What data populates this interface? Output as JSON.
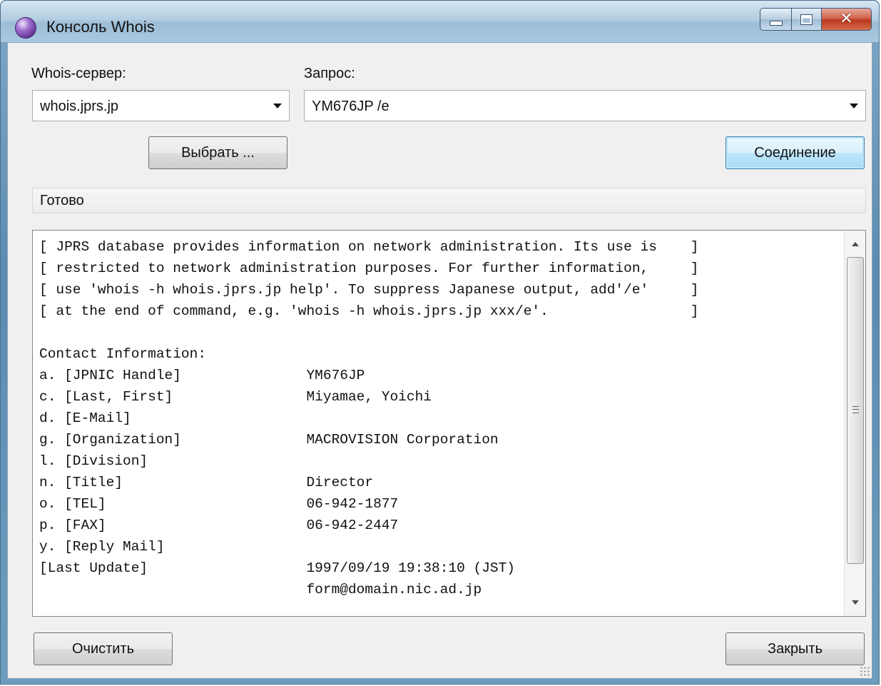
{
  "window": {
    "title": "Консоль Whois"
  },
  "server": {
    "label": "Whois-сервер:",
    "value": "whois.jprs.jp",
    "choose_button": "Выбрать ..."
  },
  "query": {
    "label": "Запрос:",
    "value": "YM676JP /e",
    "connect_button": "Соединение"
  },
  "status": {
    "text": "Готово"
  },
  "output": {
    "lines": [
      "[ JPRS database provides information on network administration. Its use is    ]",
      "[ restricted to network administration purposes. For further information,     ]",
      "[ use 'whois -h whois.jprs.jp help'. To suppress Japanese output, add'/e'     ]",
      "[ at the end of command, e.g. 'whois -h whois.jprs.jp xxx/e'.                 ]",
      "",
      "Contact Information:",
      "a. [JPNIC Handle]               YM676JP",
      "c. [Last, First]                Miyamae, Yoichi",
      "d. [E-Mail]",
      "g. [Organization]               MACROVISION Corporation",
      "l. [Division]",
      "n. [Title]                      Director",
      "o. [TEL]                        06-942-1877",
      "p. [FAX]                        06-942-2447",
      "y. [Reply Mail]",
      "[Last Update]                   1997/09/19 19:38:10 (JST)",
      "                                form@domain.nic.ad.jp"
    ]
  },
  "footer": {
    "clear_button": "Очистить",
    "close_button": "Закрыть"
  },
  "icons": {
    "app": "globe-icon",
    "minimize": "minimize-icon",
    "maximize": "maximize-icon",
    "close": "close-icon"
  }
}
